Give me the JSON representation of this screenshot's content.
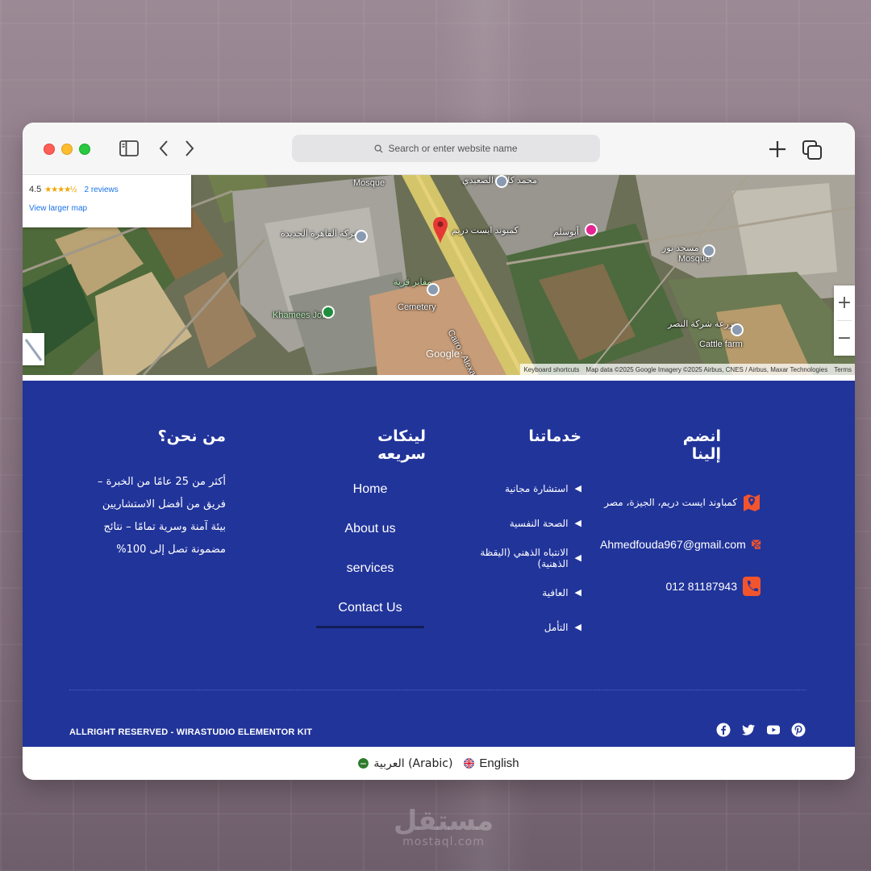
{
  "browser": {
    "address_placeholder": "Search or enter website name"
  },
  "map": {
    "card": {
      "rating": "4.5",
      "stars": "★★★★½",
      "reviews": "2 reviews",
      "larger_map": "View larger map"
    },
    "labels": {
      "pin_name": "كمبوند ايست دريم",
      "mosque": "Mosque",
      "cemetery": "Cemetery",
      "khamees": "Khamees Jow",
      "abu_salem": "أبوسلم",
      "masjid_nour": "مسجد نور",
      "mohamed_kamel": "محمد كامل الصعيدي",
      "cairo_co": "شركة القاهرة الجديدة",
      "cemetery_ar": "مقابر قرية",
      "farm": "مزرعة شركة النصر",
      "cattle": "Cattle farm",
      "road": "Cairo - Alexandria Desert"
    },
    "google_logo": "Google",
    "attribution": {
      "shortcuts": "Keyboard shortcuts",
      "data": "Map data ©2025 Google Imagery ©2025 Airbus, CNES / Airbus, Maxar Technologies",
      "terms": "Terms"
    },
    "zoom_in": "+",
    "zoom_out": "−"
  },
  "footer": {
    "about": {
      "title": "من نحن؟",
      "line1": "أكثر من 25 عامًا من الخبرة – فريق من أفضل الاستشاريين",
      "line2": "بيئة آمنة وسرية تمامًا – نتائج مضمونة تصل إلى 100%"
    },
    "quick_links": {
      "title": "لينكات سريعه",
      "items": [
        "Home",
        "About us",
        "services",
        "Contact Us"
      ]
    },
    "services": {
      "title": "خدماتنا",
      "items": [
        "استشارة مجانية",
        "الصحة النفسية",
        "الانتباه الذهني (اليقظة الذهنية)",
        "العافية",
        "التأمل"
      ]
    },
    "contact": {
      "title": "انضم إلينا",
      "address": "كمباوند ايست دريم، الجيزة، مصر",
      "email": "Ahmedfouda967@gmail.com",
      "phone": "012 81187943"
    },
    "copyright": "ALLRIGHT RESERVED - WIRASTUDIO ELEMENTOR KIT",
    "socials": [
      "facebook-icon",
      "twitter-icon",
      "youtube-icon",
      "pinterest-icon"
    ],
    "colors": {
      "background": "#21349a",
      "accent_icon": "#f2542d"
    }
  },
  "language_bar": {
    "arabic": "العربية (Arabic)",
    "english": "English"
  },
  "watermark": {
    "arabic": "مستقل",
    "latin": "mostaql.com"
  }
}
